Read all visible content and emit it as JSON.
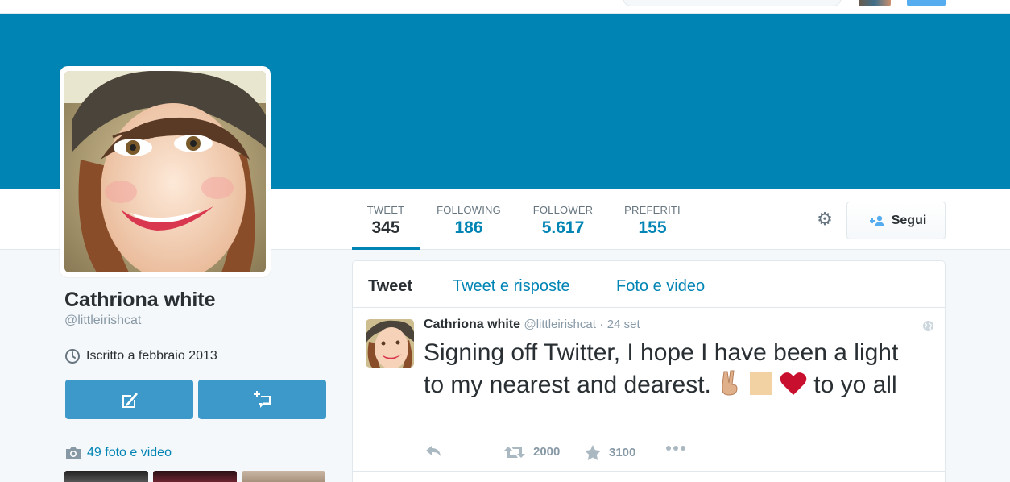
{
  "profile": {
    "name": "Cathriona white",
    "handle": "@littleirishcat",
    "joined": "Iscritto a febbraio 2013",
    "photos_label": "49 foto e video"
  },
  "stats": {
    "tweet": {
      "label": "TWEET",
      "value": "345"
    },
    "following": {
      "label": "FOLLOWING",
      "value": "186"
    },
    "follower": {
      "label": "FOLLOWER",
      "value": "5.617"
    },
    "preferiti": {
      "label": "PREFERITI",
      "value": "155"
    }
  },
  "follow_button": {
    "label": "Segui"
  },
  "tabs": {
    "tweet": "Tweet",
    "replies": "Tweet e risposte",
    "media": "Foto e video"
  },
  "tweet": {
    "name": "Cathriona white",
    "handle": "@littleirishcat",
    "separator": "·",
    "time": "24 set",
    "text_before_emoji": "Signing off Twitter, I hope I have been a light to my nearest and dearest.",
    "text_after_emoji": "to yo all",
    "retweets": "2000",
    "favorites": "3100"
  },
  "colors": {
    "banner": "#0084b4",
    "link": "#0084b4",
    "action_button": "#3d99c9"
  },
  "icons": [
    "gear-icon",
    "add-user-icon",
    "clock-icon",
    "compose-mention-icon",
    "direct-message-icon",
    "camera-icon",
    "globe-icon",
    "reply-icon",
    "retweet-icon",
    "star-icon",
    "more-icon",
    "victory-hand-emoji",
    "square-emoji",
    "heart-emoji"
  ]
}
